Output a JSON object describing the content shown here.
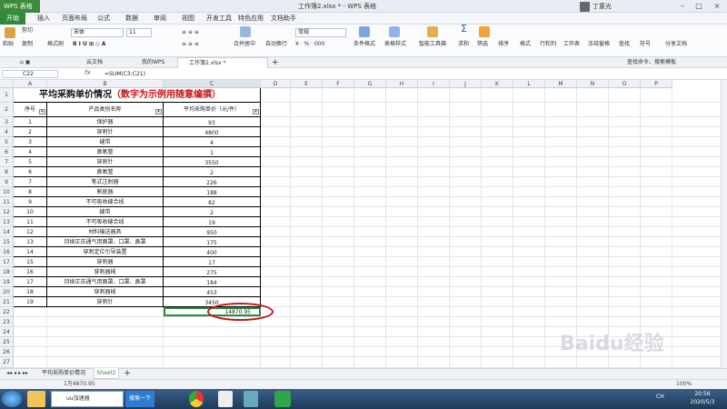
{
  "app": {
    "badge": "WPS 表格",
    "doc_title": "工作簿2.xlsx * - WPS 表格",
    "user": "丁童光"
  },
  "menu": [
    "开始",
    "插入",
    "页面布局",
    "公式",
    "数据",
    "审阅",
    "视图",
    "开发工具",
    "特色应用",
    "文档助手"
  ],
  "ribbon": {
    "paste": "粘贴",
    "cut": "剪切",
    "copy": "复制",
    "format_painter": "格式刷",
    "font_name": "宋体",
    "font_size": "11",
    "merge": "合并居中",
    "wrap": "自动换行",
    "number_format": "常规",
    "cond_format": "条件格式",
    "table_style": "表格样式",
    "smart_toolbox": "智能工具箱",
    "sum": "求和",
    "filter": "筛选",
    "sort": "排序",
    "format": "格式",
    "rowcol": "行和列",
    "sheet": "工作表",
    "freeze": "冻结窗格",
    "find": "查找",
    "symbol": "符号",
    "share": "分享文档",
    "search_cmd": "查找命令、搜索模板"
  },
  "doc_tabs": {
    "cloud": "云文档",
    "mywps": "我的WPS",
    "active": "工作簿2.xlsx *",
    "add": "+"
  },
  "formula_bar": {
    "name_box": "C22",
    "fx": "fx",
    "formula": "=SUM(C3:C21)"
  },
  "columns": [
    "A",
    "B",
    "C",
    "D",
    "E",
    "F",
    "G",
    "H",
    "I",
    "J",
    "K",
    "L",
    "M",
    "N",
    "O",
    "P"
  ],
  "sheet": {
    "title_black": "平均采购单价情况",
    "title_red": "（数字为示例用随意编撰）",
    "headers": [
      "序号",
      "产品类别名称",
      "平均采购单价（元/件）"
    ],
    "rows": [
      [
        "1",
        "保护器",
        "93"
      ],
      [
        "2",
        "穿刺针",
        "4800"
      ],
      [
        "3",
        "缝带",
        "4"
      ],
      [
        "4",
        "鼻氧管",
        "1"
      ],
      [
        "5",
        "穿刺针",
        "3550"
      ],
      [
        "6",
        "鼻氧管",
        "2"
      ],
      [
        "7",
        "笔式注射器",
        "226"
      ],
      [
        "8",
        "割庭器",
        "188"
      ],
      [
        "9",
        "不可吸收缝合线",
        "82"
      ],
      [
        "10",
        "缝带",
        "2"
      ],
      [
        "11",
        "不可吸收缝合线",
        "19"
      ],
      [
        "12",
        "材料输送器具",
        "950"
      ],
      [
        "13",
        "持续正压通气用面罩、口罩、鼻罩",
        "175"
      ],
      [
        "14",
        "穿刺定位引导装置",
        "400"
      ],
      [
        "15",
        "穿刺器",
        "17"
      ],
      [
        "16",
        "穿刺器械",
        "275"
      ],
      [
        "17",
        "持续正压通气用面罩、口罩、鼻罩",
        "184"
      ],
      [
        "18",
        "穿刺器械",
        "453"
      ],
      [
        "19",
        "穿刺针",
        "3450"
      ]
    ],
    "total": "14870.95"
  },
  "sheet_tabs": [
    "平均采购单价情况",
    "Sheet2"
  ],
  "status": {
    "sum": "1万4870.95",
    "zoom": "100%"
  },
  "taskbar": {
    "app1": "uu加速器",
    "search": "搜索一下",
    "time": "20:56",
    "date": "2020/5/3",
    "lang": "CH"
  },
  "watermark": "Baidu经验"
}
